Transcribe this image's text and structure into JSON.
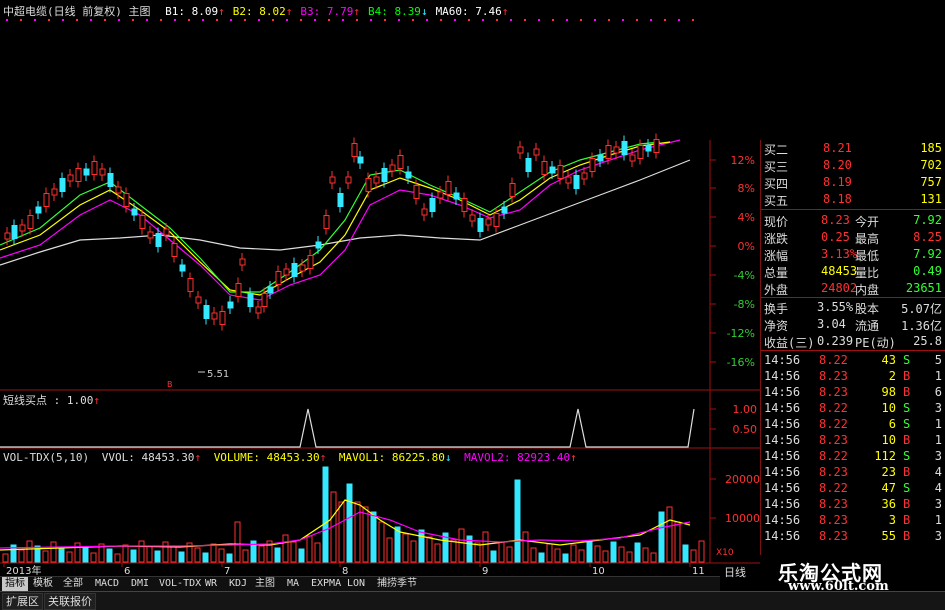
{
  "header": {
    "title": "中超电缆(日线 前复权) 主图",
    "items": [
      {
        "label": "B1: 8.09",
        "arrow": "↑",
        "color": "#ffffff"
      },
      {
        "label": "B2: 8.02",
        "arrow": "↑",
        "color": "#ffff00"
      },
      {
        "label": "B3: 7.79",
        "arrow": "↑",
        "color": "#ff00ff"
      },
      {
        "label": "B4: 8.39",
        "arrow": "↓",
        "color": "#00ff00"
      },
      {
        "label": "MA60: 7.46",
        "arrow": "↑",
        "color": "#ffffff"
      }
    ]
  },
  "main_axis_labels": [
    "12%",
    "8%",
    "4%",
    "0%",
    "-4%",
    "-8%",
    "-12%",
    "-16%"
  ],
  "low_marker": "5.51",
  "indicator": {
    "title": "短线买点 : 1.00",
    "arrow": "↑",
    "axis": [
      "1.00",
      "0.50"
    ]
  },
  "volume": {
    "title": "VOL-TDX(5,10)",
    "vvol": "VVOL: 48453.30",
    "volume": "VOLUME: 48453.30",
    "mavol1": "MAVOL1: 86225.80",
    "mavol2": "MAVOL2: 82923.40",
    "axis": [
      "20000",
      "10000"
    ],
    "unit": "X10"
  },
  "x_axis": {
    "labels": [
      "2013年",
      "6",
      "7",
      "8",
      "9",
      "10",
      "11"
    ],
    "period": "日线"
  },
  "order_book": [
    {
      "name": "买二",
      "price": "8.21",
      "vol": "185"
    },
    {
      "name": "买三",
      "price": "8.20",
      "vol": "702"
    },
    {
      "name": "买四",
      "price": "8.19",
      "vol": "757"
    },
    {
      "name": "买五",
      "price": "8.18",
      "vol": "131"
    }
  ],
  "quote": [
    {
      "l1": "现价",
      "v1": "8.23",
      "l2": "今开",
      "v2": "7.92"
    },
    {
      "l1": "涨跌",
      "v1": "0.25",
      "l2": "最高",
      "v2": "8.25"
    },
    {
      "l1": "涨幅",
      "v1": "3.13%",
      "l2": "最低",
      "v2": "7.92"
    },
    {
      "l1": "总量",
      "v1": "48453",
      "l2": "量比",
      "v2": "0.49"
    },
    {
      "l1": "外盘",
      "v1": "24802",
      "l2": "内盘",
      "v2": "23651"
    }
  ],
  "stats": [
    {
      "l1": "换手",
      "v1": "3.55%",
      "l2": "股本",
      "v2": "5.07亿"
    },
    {
      "l1": "净资",
      "v1": "3.04",
      "l2": "流通",
      "v2": "1.36亿"
    },
    {
      "l1": "收益(三)",
      "v1": "0.239",
      "l2": "PE(动)",
      "v2": "25.8"
    }
  ],
  "ticks": [
    {
      "time": "14:56",
      "price": "8.22",
      "vol": "43",
      "side": "S",
      "n": "5"
    },
    {
      "time": "14:56",
      "price": "8.23",
      "vol": "2",
      "side": "B",
      "n": "1"
    },
    {
      "time": "14:56",
      "price": "8.23",
      "vol": "98",
      "side": "B",
      "n": "6"
    },
    {
      "time": "14:56",
      "price": "8.22",
      "vol": "10",
      "side": "S",
      "n": "3"
    },
    {
      "time": "14:56",
      "price": "8.22",
      "vol": "6",
      "side": "S",
      "n": "1"
    },
    {
      "time": "14:56",
      "price": "8.23",
      "vol": "10",
      "side": "B",
      "n": "1"
    },
    {
      "time": "14:56",
      "price": "8.22",
      "vol": "112",
      "side": "S",
      "n": "3"
    },
    {
      "time": "14:56",
      "price": "8.23",
      "vol": "23",
      "side": "B",
      "n": "4"
    },
    {
      "time": "14:56",
      "price": "8.22",
      "vol": "47",
      "side": "S",
      "n": "4"
    },
    {
      "time": "14:56",
      "price": "8.23",
      "vol": "36",
      "side": "B",
      "n": "3"
    },
    {
      "time": "14:56",
      "price": "8.23",
      "vol": "3",
      "side": "B",
      "n": "1"
    },
    {
      "time": "14:56",
      "price": "8.23",
      "vol": "55",
      "side": "B",
      "n": "3"
    }
  ],
  "tabs": [
    "指标",
    "模板",
    "全部",
    "MACD",
    "DMI",
    "VOL-TDX",
    "WR",
    "KDJ",
    "主图",
    "MA",
    "EXPMA",
    "LON",
    "捕捞季节"
  ],
  "active_tab": "指标",
  "bottom_buttons": [
    "扩展区",
    "关联报价"
  ],
  "watermark": {
    "line1": "乐淘公式网",
    "line2": "www.60lt.com"
  },
  "colors": {
    "up": "#ff3030",
    "down": "#33e8ff",
    "axis": "#a01010",
    "pos": "#ff3030",
    "neg": "#33cc33"
  }
}
